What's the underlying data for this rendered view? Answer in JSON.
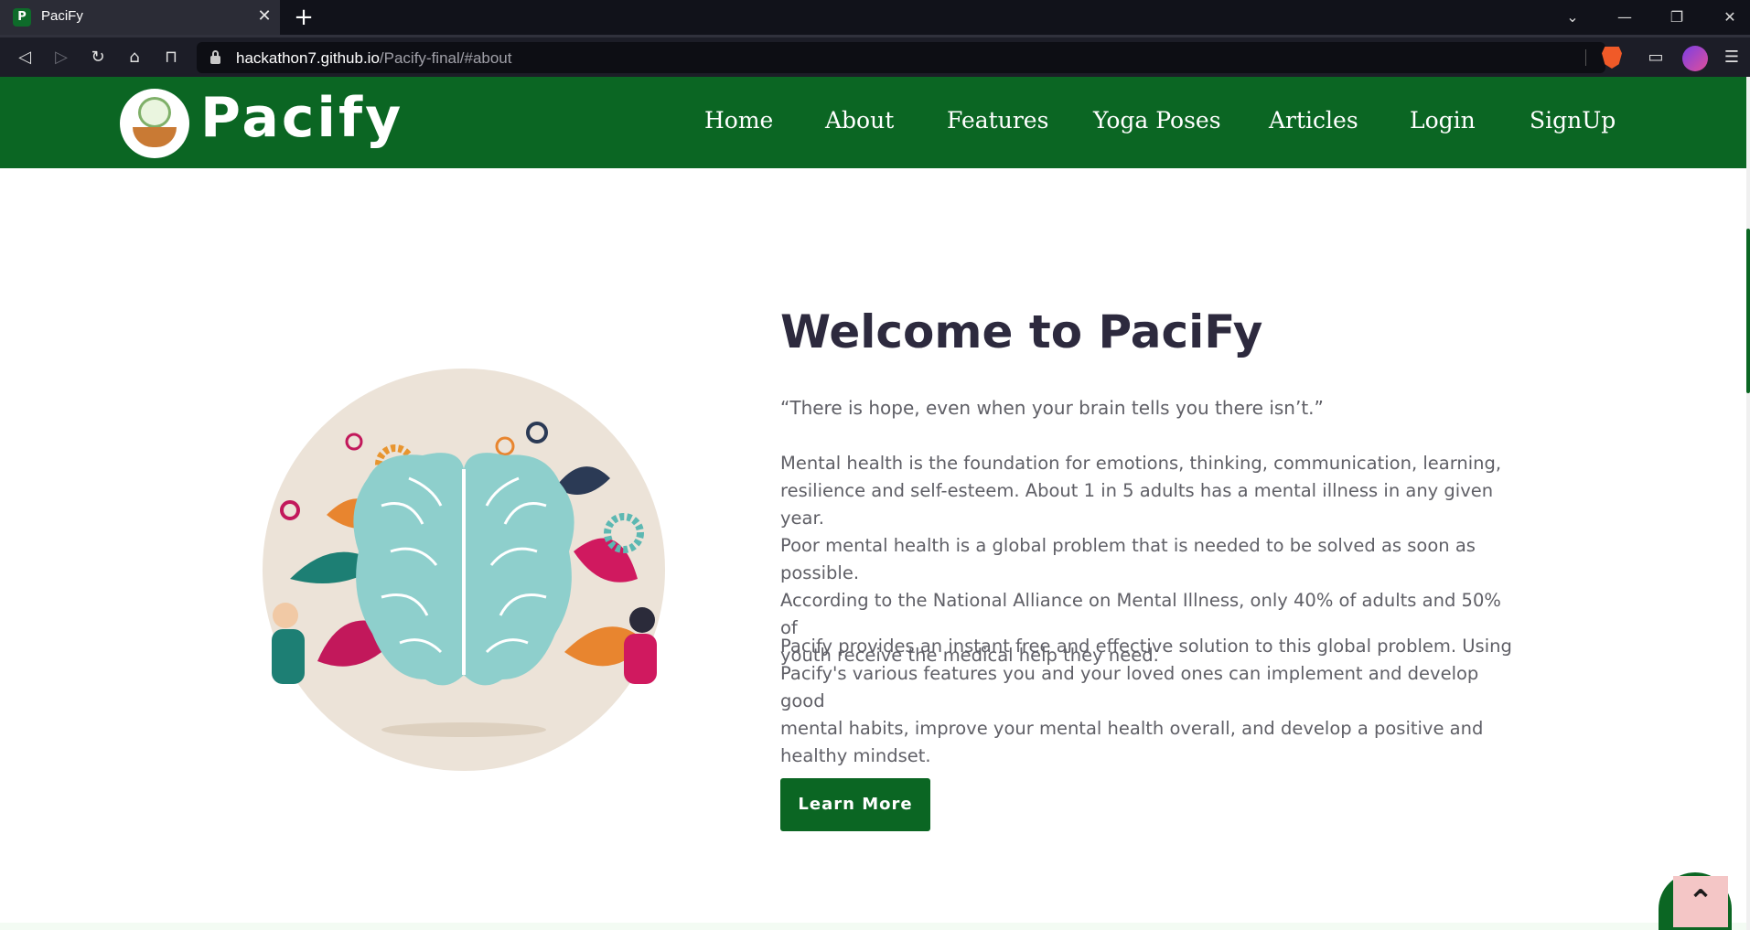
{
  "browser": {
    "tab_title": "PaciFy",
    "tab_favicon_letter": "P",
    "tab_close_icon": "close-icon",
    "new_tab_icon": "plus-icon",
    "url_host": "hackathon7.github.io",
    "url_path": "/Pacify-final/#about"
  },
  "header": {
    "logo_text": "Pacify",
    "nav": [
      "Home",
      "About",
      "Features",
      "Yoga Poses",
      "Articles",
      "Login",
      "SignUp"
    ]
  },
  "about": {
    "heading": "Welcome to PaciFy",
    "quote": "“There is hope, even when your brain tells you there isn’t.”",
    "para1_lines": [
      "Mental health is the foundation for emotions, thinking, communication, learning,",
      "resilience and self-esteem. About 1 in 5 adults has a mental illness in any given year.",
      "Poor mental health is a global problem that is needed to be solved as soon as",
      "possible.",
      "According to the National Alliance on Mental Illness, only 40% of adults and 50% of",
      "youth receive the medical help they need."
    ],
    "para2_lines": [
      "Pacify provides an instant free and effective solution to this global problem. Using",
      "Pacify's various features you and your loved ones can implement and develop good",
      "mental habits, improve your mental health overall, and develop a positive and",
      "healthy mindset."
    ],
    "button_label": "Learn More"
  },
  "colors": {
    "brand_green": "#0b6623",
    "heading": "#2d2a3e",
    "body_text": "#5f5f66",
    "scroll_top_bg": "#f4c6c6"
  }
}
